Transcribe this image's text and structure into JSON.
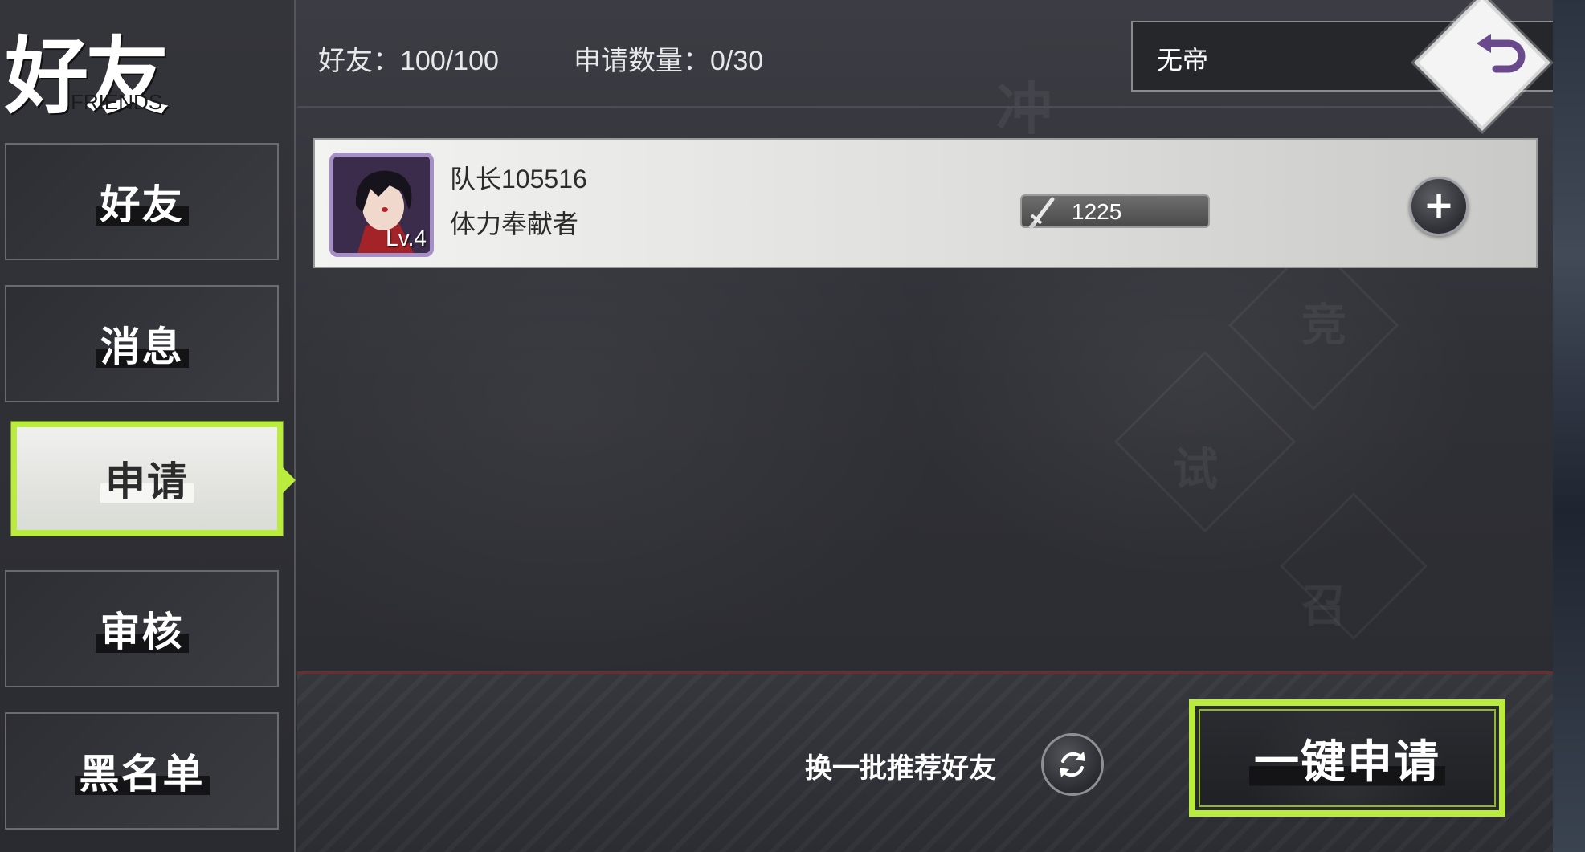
{
  "page": {
    "title": "好友",
    "subtitle": "FRIENDS"
  },
  "sidebar": {
    "items": [
      {
        "label": "好友",
        "active": false
      },
      {
        "label": "消息",
        "active": false
      },
      {
        "label": "申请",
        "active": true
      },
      {
        "label": "审核",
        "active": false
      },
      {
        "label": "黑名单",
        "active": false
      }
    ]
  },
  "header": {
    "friends_count": "好友：100/100",
    "requests_count": "申请数量：0/30",
    "search": {
      "value": "无帝",
      "icon": "search-icon"
    },
    "back_icon": "back-icon"
  },
  "friends": [
    {
      "name": "队长105516",
      "title": "体力奉献者",
      "level": "Lv.4",
      "power": "1225",
      "power_icon": "sword-icon",
      "action_icon": "plus-icon"
    }
  ],
  "footer": {
    "refresh_label": "换一批推荐好友",
    "refresh_icon": "refresh-icon",
    "apply_all_label": "一键申请"
  },
  "colors": {
    "accent": "#b9ec3c",
    "panel": "#2f3036",
    "card": "#e6e6e4"
  }
}
